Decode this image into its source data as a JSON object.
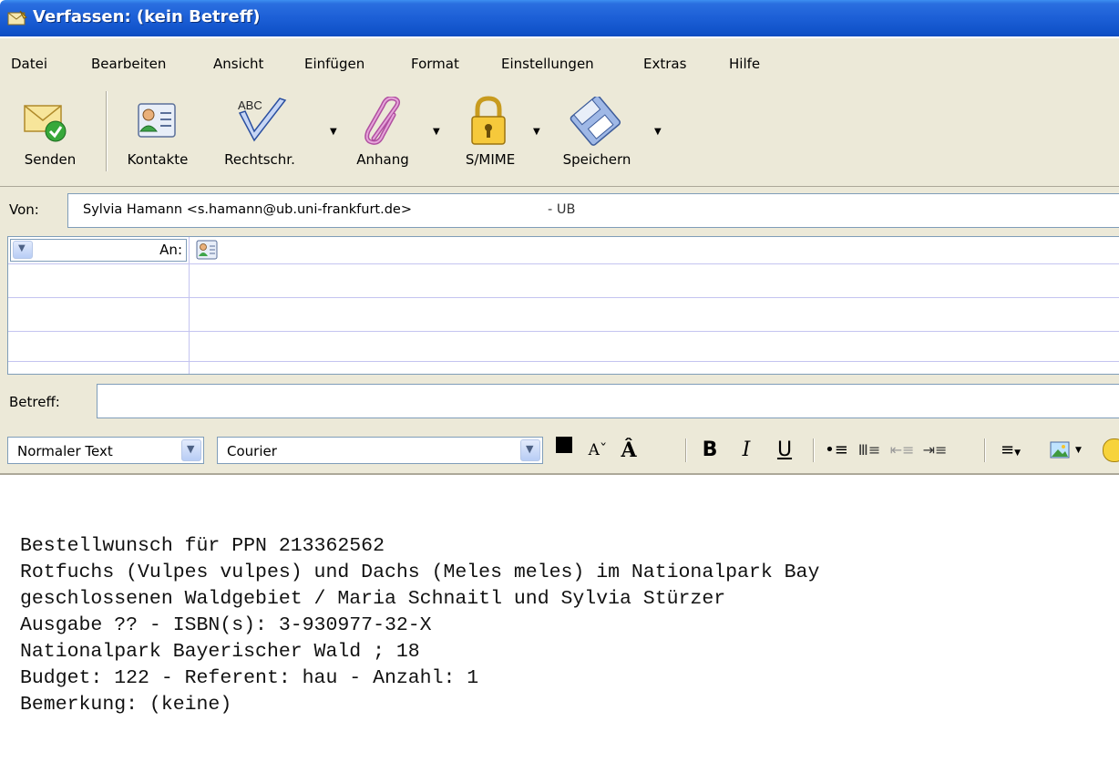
{
  "window": {
    "title": "Verfassen: (kein Betreff)"
  },
  "menu": [
    "Datei",
    "Bearbeiten",
    "Ansicht",
    "Einfügen",
    "Format",
    "Einstellungen",
    "Extras",
    "Hilfe"
  ],
  "toolbar": {
    "send": "Senden",
    "contacts": "Kontakte",
    "spelling": "Rechtschr.",
    "attach": "Anhang",
    "smime": "S/MIME",
    "save": "Speichern",
    "spelling_icon_text": "ABC"
  },
  "from": {
    "label": "Von:",
    "value": "Sylvia Hamann <s.hamann@ub.uni-frankfurt.de>",
    "suffix": "- UB"
  },
  "recipient": {
    "type": "An:"
  },
  "subject": {
    "label": "Betreff:",
    "value": ""
  },
  "format": {
    "paragraph_style": "Normaler Text",
    "font": "Courier",
    "text_color": "#000000"
  },
  "body_lines": [
    "Bestellwunsch für PPN 213362562",
    "Rotfuchs (Vulpes vulpes) und Dachs (Meles meles) im Nationalpark Bay",
    "geschlossenen Waldgebiet / Maria Schnaitl und Sylvia Stürzer",
    "Ausgabe ?? - ISBN(s): 3-930977-32-X",
    "Nationalpark Bayerischer Wald ; 18",
    "Budget: 122 - Referent: hau - Anzahl: 1",
    "Bemerkung: (keine)"
  ]
}
